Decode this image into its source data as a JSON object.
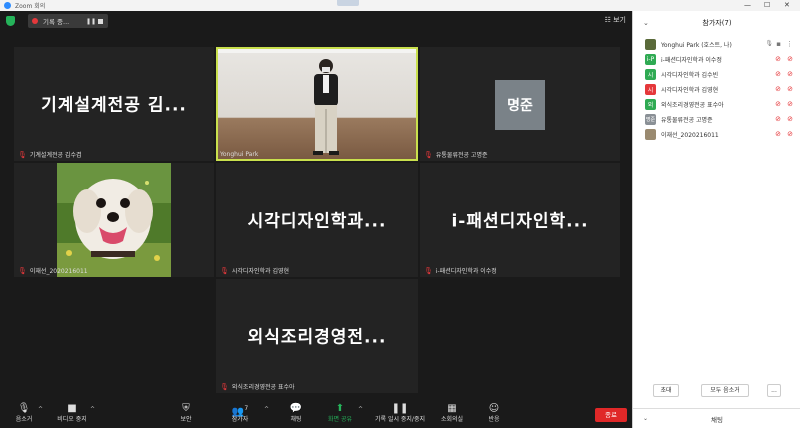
{
  "window": {
    "title": "Zoom 회의",
    "controls": {
      "minimize": "—",
      "maximize": "☐",
      "close": "✕"
    }
  },
  "recording": {
    "label": "기록 중..."
  },
  "top_right": {
    "view_label": "☷ 보기"
  },
  "tiles": [
    {
      "name": "기계설계전공 김...",
      "label": "기계설계전공 김수겸",
      "muted": true
    },
    {
      "name": "",
      "label": "Yonghui Park",
      "muted": false
    },
    {
      "name": "명준",
      "label": "유통물류전공 고명준",
      "muted": true
    },
    {
      "name": "",
      "label": "이재선_2020216011",
      "muted": true
    },
    {
      "name": "시각디자인학과...",
      "label": "시각디자인학과 김영현",
      "muted": true
    },
    {
      "name": "i-패션디자인학...",
      "label": "i-패션디자인학과 이수정",
      "muted": true
    },
    {
      "name": "외식조리경영전...",
      "label": "외식조리경영전공 표수아",
      "muted": true
    }
  ],
  "toolbar": {
    "mute": "음소거",
    "video": "비디오 중지",
    "security": "보안",
    "participants": "참가자",
    "participants_count": "7",
    "chat": "채팅",
    "share": "화면 공유",
    "record": "기록 일시 중지/중지",
    "rooms": "소회의실",
    "reactions": "반응",
    "end": "종료"
  },
  "panel": {
    "title": "참가자(7)",
    "participants": [
      {
        "name": "Yonghui Park (호스트, 나)",
        "initial": "",
        "color": "#5a6a3a",
        "host": true
      },
      {
        "name": "i-패션디자인학과 이수정",
        "initial": "i-P",
        "color": "#2faa53"
      },
      {
        "name": "시각디자인학과 김수빈",
        "initial": "시",
        "color": "#2faa53"
      },
      {
        "name": "시각디자인학과 김영현",
        "initial": "시",
        "color": "#e5383b"
      },
      {
        "name": "외식조리경영전공 표수아",
        "initial": "외",
        "color": "#2faa53"
      },
      {
        "name": "유통물류전공 고명준",
        "initial": "명준",
        "color": "#8a9096"
      },
      {
        "name": "이재선_2020216011",
        "initial": "",
        "color": "#9a8a70"
      }
    ],
    "invite": "초대",
    "mute_all": "모두 음소거",
    "more": "...",
    "chat_label": "채팅"
  }
}
